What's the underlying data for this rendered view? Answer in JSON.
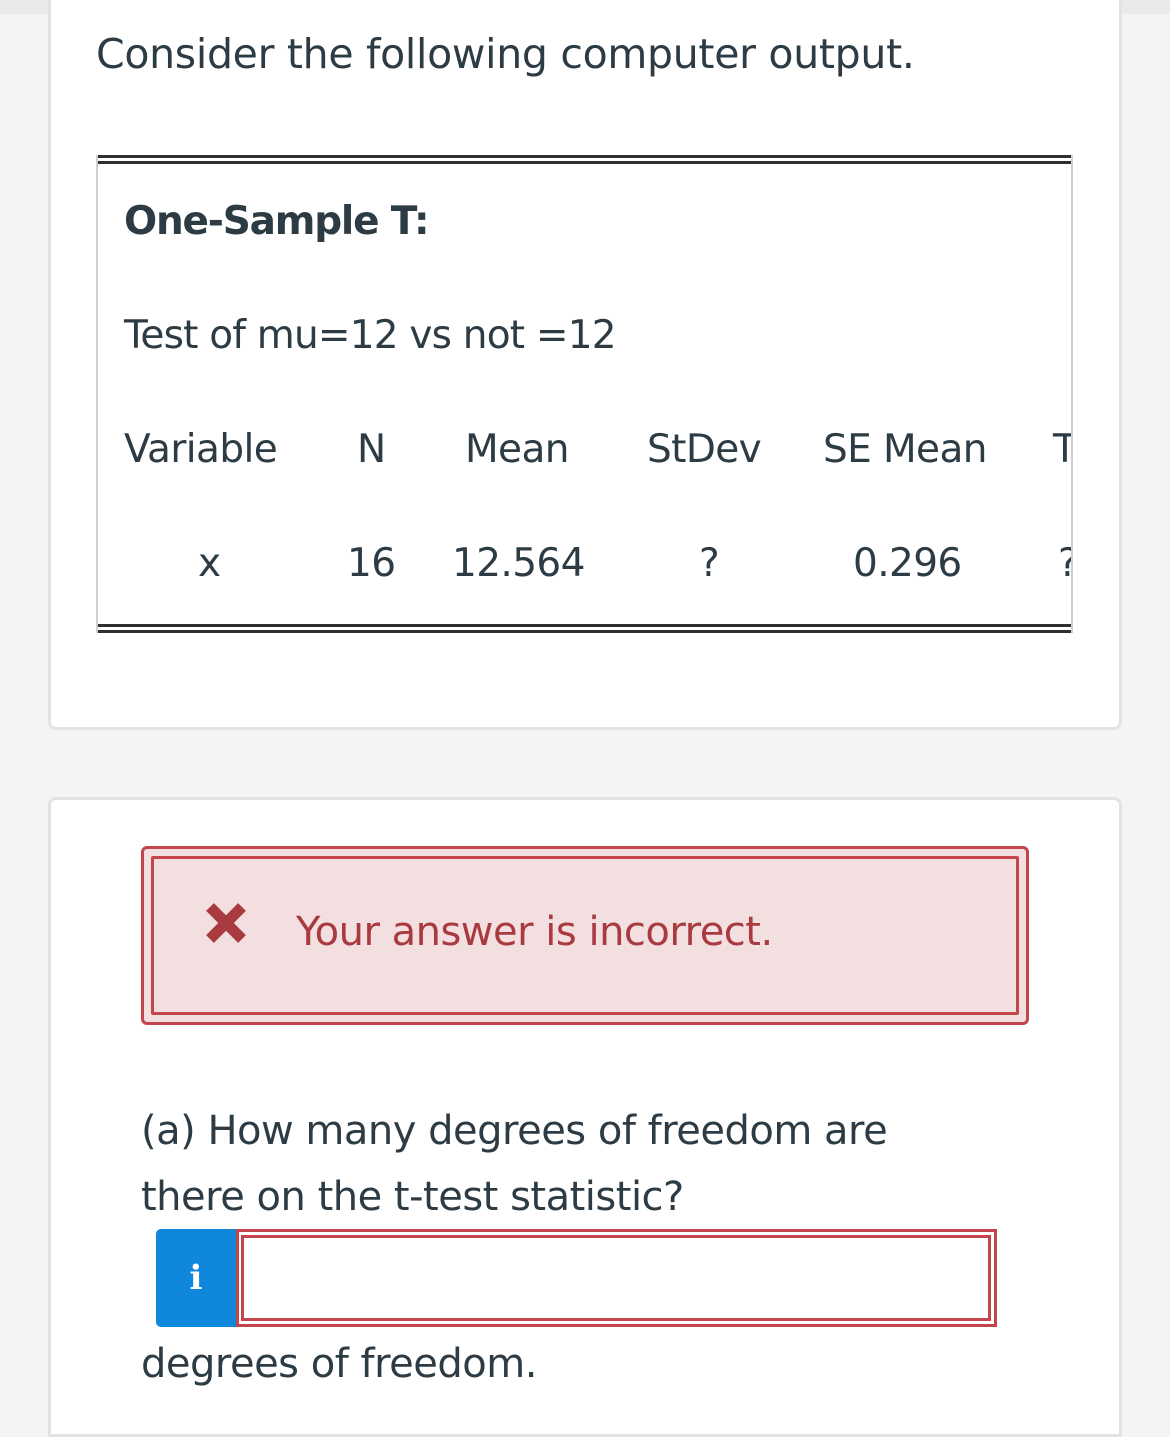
{
  "intro": "Consider the following computer output.",
  "output": {
    "title": "One-Sample T:",
    "test": "Test of mu=12 vs not =12",
    "headers": {
      "variable": "Variable",
      "n": "N",
      "mean": "Mean",
      "stdev": "StDev",
      "se_mean": "SE Mean",
      "t": "T"
    },
    "row": {
      "variable": "x",
      "n": "16",
      "mean": "12.564",
      "stdev": "?",
      "se_mean": "0.296",
      "t": "?"
    }
  },
  "feedback": {
    "icon": "x-mark-icon",
    "message": "Your answer is incorrect.",
    "color": "#c2464b"
  },
  "question": {
    "text": "(a) How many degrees of freedom are there on the t-test statistic?",
    "info_label": "i",
    "answer_value": "",
    "suffix": "degrees of freedom."
  },
  "colors": {
    "text": "#2d3b45",
    "error": "#c2464b",
    "error_bg": "#f3dfe0",
    "info": "#0f88dc"
  }
}
